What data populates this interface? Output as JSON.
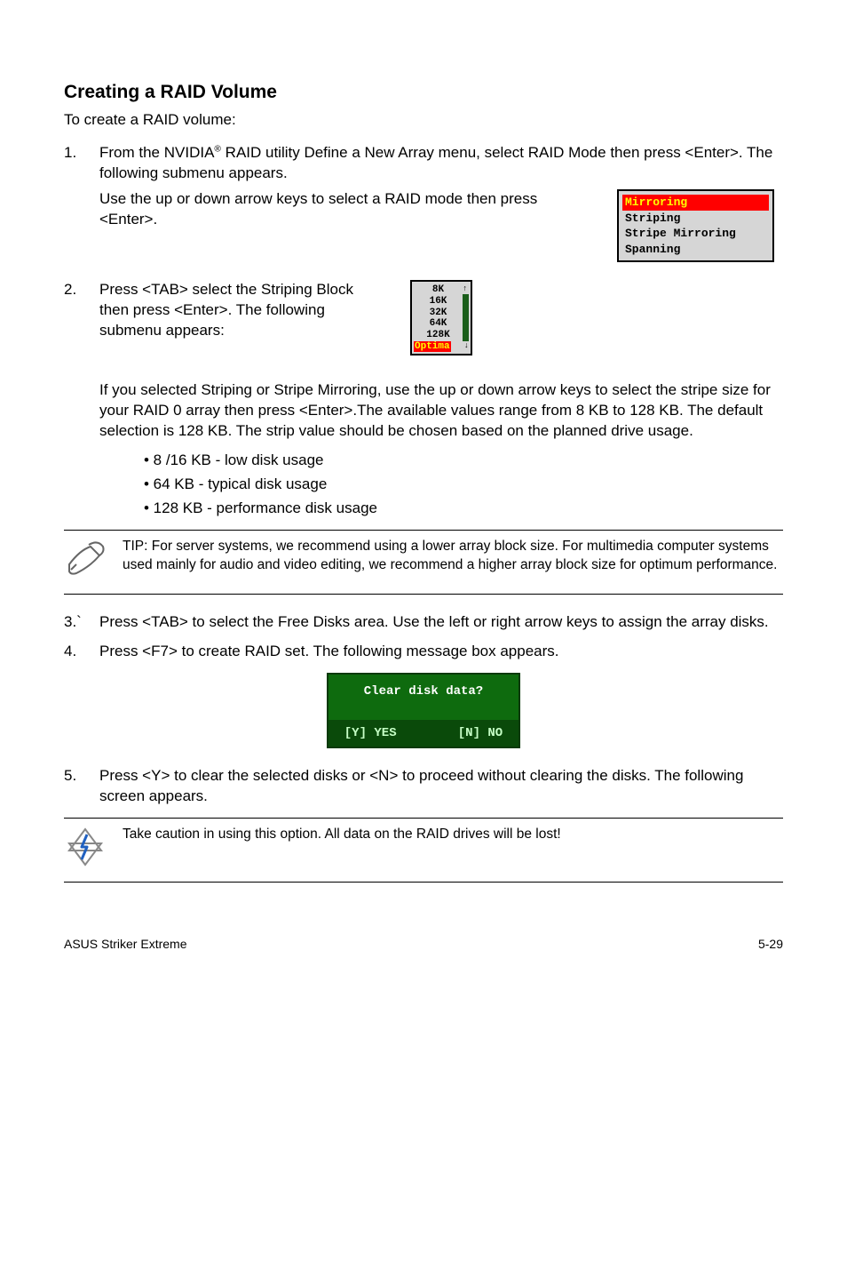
{
  "heading": "Creating a RAID Volume",
  "intro": "To create a RAID volume:",
  "step1": {
    "num": "1.",
    "para1_pre": "From the NVIDIA",
    "para1_reg": "®",
    "para1_post": " RAID utility Define a New Array menu, select RAID Mode then press <Enter>. The following submenu appears.",
    "para2": "Use the up or down arrow keys to select a RAID mode then press <Enter>."
  },
  "raid_modes": {
    "selected": "Mirroring",
    "items": [
      "Striping",
      "Stripe Mirroring",
      "Spanning"
    ]
  },
  "step2": {
    "num": "2.",
    "para1": "Press <TAB> select the Striping Block then press <Enter>. The following submenu appears:",
    "para2": "If you selected Striping or Stripe Mirroring, use the up or down arrow keys to select the stripe size for your RAID 0 array then press <Enter>.The available values range from 8 KB to 128 KB. The default selection is 128 KB. The strip value should be chosen based on the planned drive usage."
  },
  "stripe_sizes": {
    "values": [
      "8K",
      "16K",
      "32K",
      "64K",
      "128K"
    ],
    "selected": "Optima",
    "up_arrow": "↑",
    "down_arrow": "↓"
  },
  "bullets": [
    "• 8 /16 KB - low disk usage",
    "• 64 KB - typical disk usage",
    "• 128 KB - performance disk usage"
  ],
  "tip": {
    "text": "TIP: For server systems, we recommend using a lower array block size. For multimedia computer systems used mainly for audio and video editing, we recommend a higher array block size for optimum performance."
  },
  "step3": {
    "num": "3.`",
    "text": "Press <TAB> to select the Free Disks area. Use the left or right arrow keys to assign the array disks."
  },
  "step4": {
    "num": "4.",
    "text": "Press <F7> to create RAID set. The following message box appears."
  },
  "dialog": {
    "title": "Clear disk data?",
    "yes": "[Y] YES",
    "no": "[N] NO"
  },
  "step5": {
    "num": "5.",
    "text": "Press <Y> to clear the selected disks or <N> to proceed without clearing the disks. The following screen appears."
  },
  "warning": {
    "text": "Take caution in using this option. All data on the RAID drives will be lost!"
  },
  "footer": {
    "left": "ASUS Striker Extreme",
    "right": "5-29"
  }
}
